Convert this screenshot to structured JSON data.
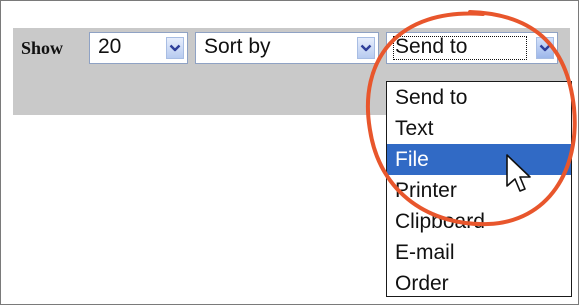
{
  "toolbar": {
    "show_label": "Show",
    "show_select": {
      "value": "20"
    },
    "sort_select": {
      "value": "Sort by"
    },
    "send_select": {
      "value": "Send to"
    }
  },
  "dropdown": {
    "items": [
      {
        "label": "Send to",
        "selected": false
      },
      {
        "label": "Text",
        "selected": false
      },
      {
        "label": "File",
        "selected": true
      },
      {
        "label": "Printer",
        "selected": false
      },
      {
        "label": "Clipboard",
        "selected": false
      },
      {
        "label": "E-mail",
        "selected": false
      },
      {
        "label": "Order",
        "selected": false
      }
    ]
  },
  "colors": {
    "toolbar_bg": "#c9c9c9",
    "highlight": "#316ac5",
    "callout": "#e8562c"
  },
  "icons": {
    "select_arrow": "chevron-down-icon",
    "cursor": "arrow-cursor-icon",
    "callout": "highlight-circle"
  }
}
